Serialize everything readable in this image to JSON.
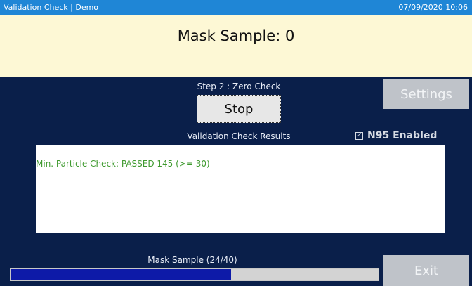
{
  "titlebar": {
    "app_title": "Validation Check | Demo",
    "datetime": "07/09/2020 10:06"
  },
  "header": {
    "title": "Mask Sample: 0"
  },
  "main": {
    "step_label": "Step 2 : Zero Check",
    "stop_label": "Stop",
    "settings_label": "Settings",
    "results_label": "Validation Check Results",
    "n95_checkbox": {
      "checked": true,
      "label": "N95 Enabled"
    },
    "results_lines": [
      "Min. Particle Check: PASSED 145 (>= 30)"
    ],
    "progress_label": "Mask Sample (24/40)",
    "progress_value": 0.6,
    "exit_label": "Exit"
  },
  "colors": {
    "titlebar_bg": "#1f86d6",
    "header_bg": "#fdf8d5",
    "main_bg": "#0a1f4a",
    "results_text": "#3f9a2f",
    "progress_fill": "#0d1aa8",
    "disabled_button": "#bfc3c9"
  }
}
